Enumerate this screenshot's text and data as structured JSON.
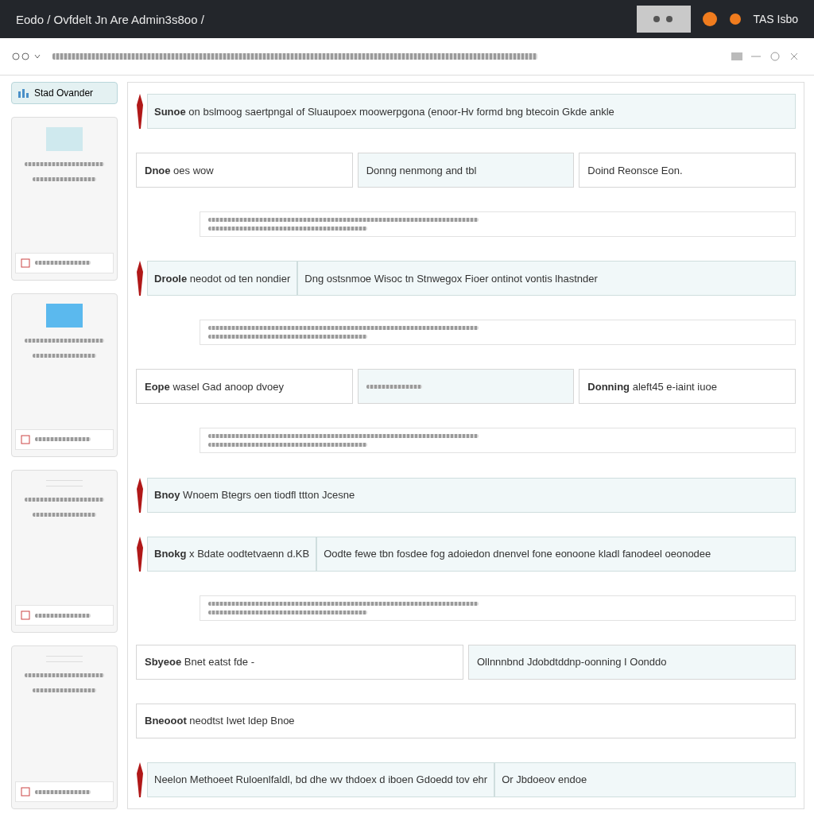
{
  "window": {
    "title": "Eodo / Ovfdelt Jn Are Admin3s8oo /"
  },
  "header": {
    "user": "TAS Isbo"
  },
  "sidebar": {
    "button": "Stad Ovander",
    "cards": [
      {
        "kind": "thumbnail",
        "color": "#cfe9ee"
      },
      {
        "kind": "thumbnail",
        "color": "#5bb9ee"
      },
      {
        "kind": "lines"
      },
      {
        "kind": "lines"
      }
    ]
  },
  "rows": [
    {
      "kind": "banner",
      "cells": [
        "**Sunoe** on bslmoog saertpngal of Sluaupoex moowerpgona (enoor-Hv formd bng btecoin Gkde ankle"
      ]
    },
    {
      "kind": "cells",
      "cells": [
        "**Dnoe** oes wow",
        "Donng nenmong and tbl",
        "Doind Reonsce Eon."
      ]
    },
    {
      "kind": "notes"
    },
    {
      "kind": "banner",
      "cells": [
        "**Droole** neodot od ten nondier",
        "Dng ostsnmoe Wisoc tn Stnwegox Fioer ontinot vontis lhastnder"
      ]
    },
    {
      "kind": "notes"
    },
    {
      "kind": "cells",
      "cells": [
        "**Eope** wasel Gad anoop dvoey",
        "",
        "**Donning** aleft45 e-iaint iuoe"
      ]
    },
    {
      "kind": "notes"
    },
    {
      "kind": "banner",
      "cells": [
        "**Bnoy** Wnoem Btegrs oen tiodfl ttton Jcesne"
      ]
    },
    {
      "kind": "banner",
      "cells": [
        "**Bnokg** x Bdate oodtetvaenn d.KB",
        "Oodte fewe tbn fosdee fog adoiedon dnenvel fone eonoone kladl fanodeel oeonodee"
      ]
    },
    {
      "kind": "notes"
    },
    {
      "kind": "cells",
      "cells": [
        "**Sbyeoe** Bnet eatst fde -",
        "Ollnnnbnd Jdobdtddnp-oonning I Oonddo"
      ]
    },
    {
      "kind": "cells",
      "cells": [
        "**Bneooot** neodtst Iwet ldep Bnoe"
      ]
    },
    {
      "kind": "banner",
      "cells": [
        "Neelon Methoeet Ruloenlfaldl, bd dhe wv thdoex d iboen Gdoedd tov ehr",
        "Or Jbdoeov endoe"
      ]
    }
  ]
}
